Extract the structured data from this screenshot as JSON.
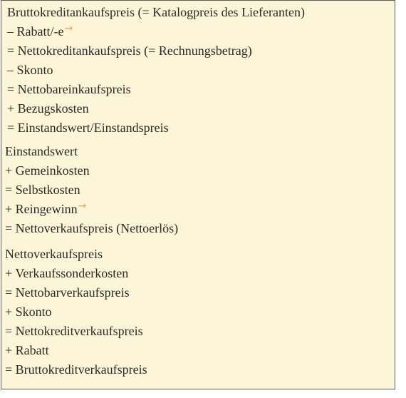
{
  "colors": {
    "background": "#fdf5d7",
    "border": "#5a5a5a",
    "text": "#2a2a2a",
    "arrow": "#f0a04a"
  },
  "section1": {
    "lines": [
      "Bruttokreditankaufspreis (= Katalogpreis des Lieferanten)",
      "– Rabatt/-e",
      "= Nettokreditankaufspreis (= Rechnungsbetrag)",
      "– Skonto",
      "= Nettobareinkaufspreis",
      "+ Bezugskosten",
      "= Einstandswert/Einstandspreis"
    ]
  },
  "section2": {
    "lines": [
      "Einstandswert",
      "+ Gemeinkosten",
      "= Selbstkosten",
      "+ Reingewinn",
      "= Nettoverkaufspreis (Nettoerlös)"
    ]
  },
  "section3": {
    "lines": [
      "Nettoverkaufspreis",
      "+ Verkaufssonderkosten",
      "= Nettobarverkaufspreis",
      "+ Skonto",
      "= Nettokreditverkaufspreis",
      "+ Rabatt",
      "= Bruttokreditverkaufspreis"
    ]
  },
  "icons": {
    "arrow": "→"
  }
}
